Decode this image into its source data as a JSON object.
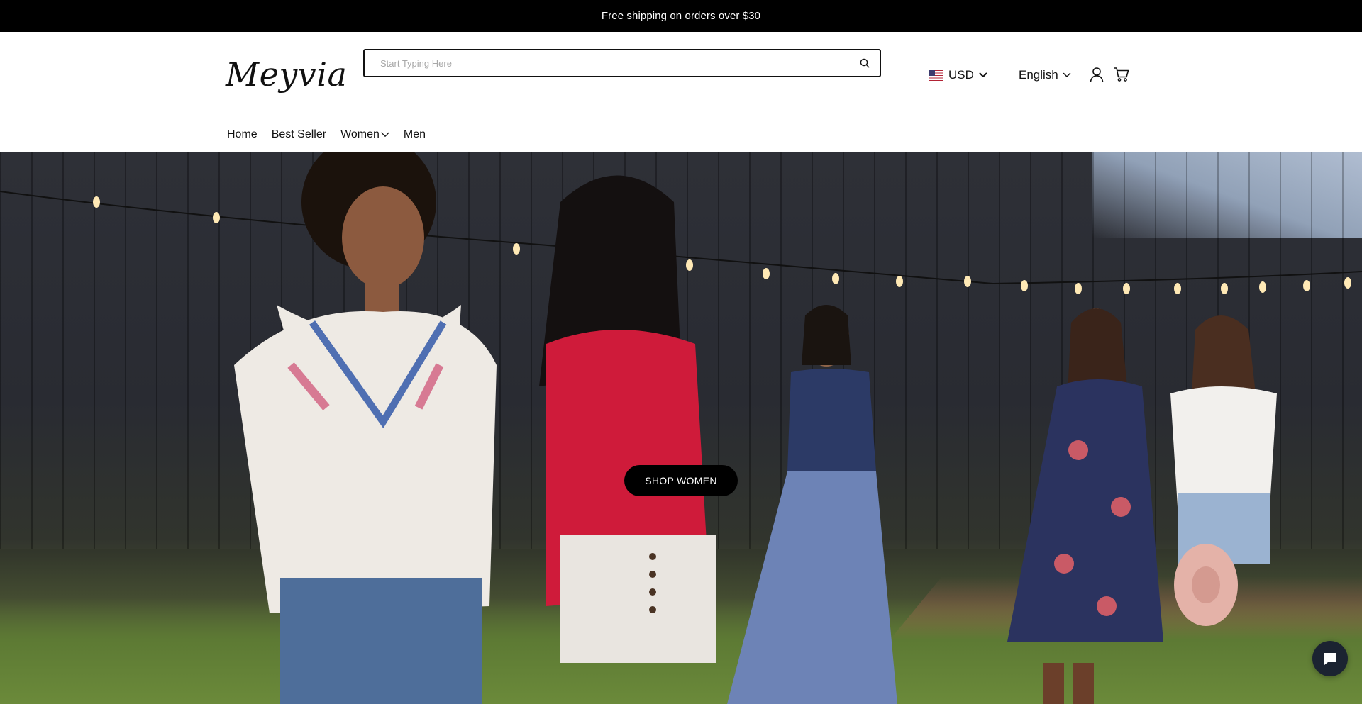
{
  "announcement": {
    "text": "Free shipping on orders over $30"
  },
  "header": {
    "logo_text": "Meyvia",
    "search": {
      "placeholder": "Start Typing Here",
      "value": ""
    },
    "currency": {
      "label": "USD",
      "flag": "us-flag-icon"
    },
    "language": {
      "label": "English"
    },
    "icons": {
      "search": "search-icon",
      "account": "user-icon",
      "cart": "cart-icon"
    }
  },
  "nav": {
    "items": [
      {
        "label": "Home"
      },
      {
        "label": "Best Seller"
      },
      {
        "label": "Women",
        "has_dropdown": true
      },
      {
        "label": "Men"
      }
    ]
  },
  "hero": {
    "cta_label": "SHOP WOMEN",
    "colors": {
      "cta_bg": "#000000",
      "cta_text": "#ffffff"
    }
  },
  "chat_widget": {
    "icon": "chat-bubble-icon"
  }
}
